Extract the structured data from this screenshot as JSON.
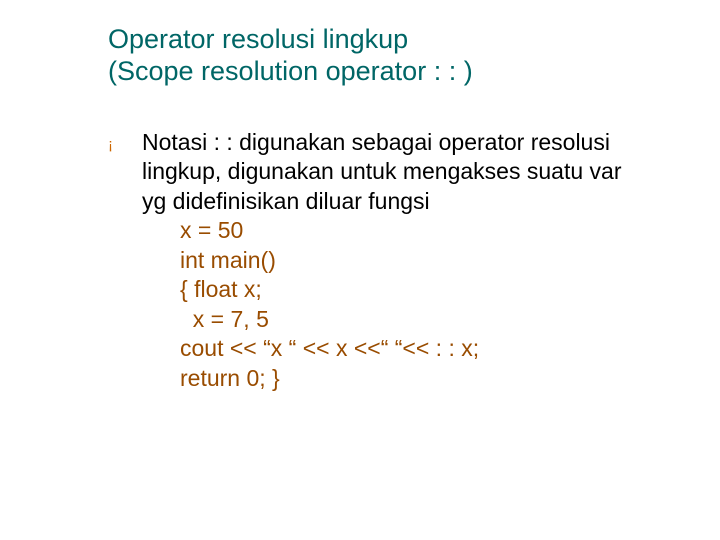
{
  "title_line1": "Operator resolusi lingkup",
  "title_line2": "(Scope resolution operator : : )",
  "bullet_glyph": "¡",
  "para": "Notasi : : digunakan sebagai operator resolusi lingkup, digunakan untuk mengakses suatu var yg didefinisikan diluar fungsi",
  "code": {
    "l1": "x = 50",
    "l2": "int main()",
    "l3": "{ float x;",
    "l4": "  x = 7, 5",
    "l5": "cout << “x “ << x <<“ “<< : : x;",
    "l6": "return 0; }"
  }
}
